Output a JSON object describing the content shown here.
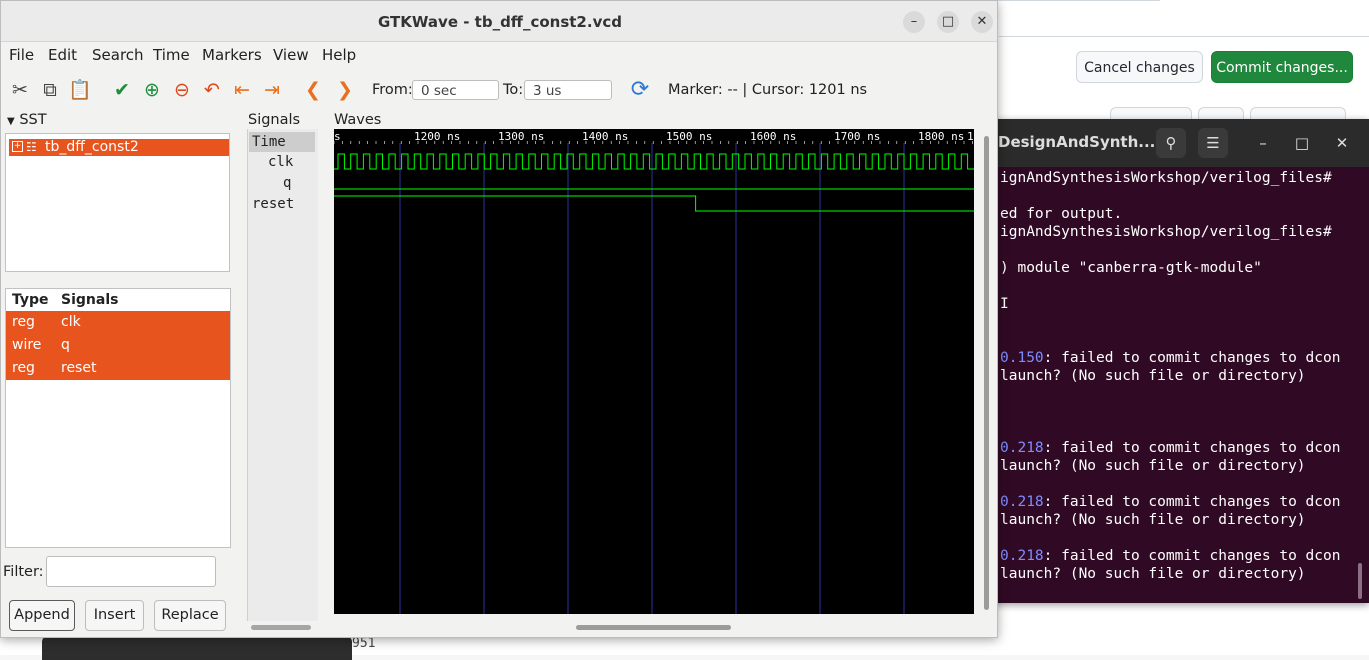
{
  "browser": {
    "cancel_label": "Cancel changes",
    "commit_label": "Commit changes...",
    "code_fragment": "951"
  },
  "terminal": {
    "title": "DesignAndSynth...",
    "lines": [
      {
        "pre": "",
        "num": "",
        "text": "ignAndSynthesisWorkshop/verilog_files#"
      },
      {
        "pre": "",
        "num": "",
        "text": ""
      },
      {
        "pre": "",
        "num": "",
        "text": "ed for output."
      },
      {
        "pre": "",
        "num": "",
        "text": "ignAndSynthesisWorkshop/verilog_files#"
      },
      {
        "pre": "",
        "num": "",
        "text": ""
      },
      {
        "pre": "",
        "num": "",
        "text": ") module \"canberra-gtk-module\""
      },
      {
        "pre": "",
        "num": "",
        "text": ""
      },
      {
        "pre": "",
        "num": "",
        "text": "I"
      },
      {
        "pre": "",
        "num": "",
        "text": ""
      },
      {
        "pre": "",
        "num": "",
        "text": ""
      },
      {
        "pre": "",
        "num": "0.150",
        "text": ": failed to commit changes to dcon"
      },
      {
        "pre": "",
        "num": "",
        "text": "launch? (No such file or directory)"
      },
      {
        "pre": "",
        "num": "",
        "text": ""
      },
      {
        "pre": "",
        "num": "",
        "text": ""
      },
      {
        "pre": "",
        "num": "",
        "text": ""
      },
      {
        "pre": "",
        "num": "0.218",
        "text": ": failed to commit changes to dcon"
      },
      {
        "pre": "",
        "num": "",
        "text": "launch? (No such file or directory)"
      },
      {
        "pre": "",
        "num": "",
        "text": ""
      },
      {
        "pre": "",
        "num": "0.218",
        "text": ": failed to commit changes to dcon"
      },
      {
        "pre": "",
        "num": "",
        "text": "launch? (No such file or directory)"
      },
      {
        "pre": "",
        "num": "",
        "text": ""
      },
      {
        "pre": "",
        "num": "0.218",
        "text": ": failed to commit changes to dcon"
      },
      {
        "pre": "",
        "num": "",
        "text": "launch? (No such file or directory)"
      }
    ]
  },
  "gtkwave": {
    "title": "GTKWave - tb_dff_const2.vcd",
    "menu": [
      "File",
      "Edit",
      "Search",
      "Time",
      "Markers",
      "View",
      "Help"
    ],
    "toolbar": {
      "from_label": "From:",
      "from_value": "0 sec",
      "to_label": "To:",
      "to_value": "3 us",
      "marker_text": "Marker: -- | Cursor: 1201 ns"
    },
    "sst_label": "SST",
    "sst_item": "tb_dff_const2",
    "signals_table": {
      "headers": [
        "Type",
        "Signals"
      ],
      "rows": [
        {
          "type": "reg",
          "name": "clk"
        },
        {
          "type": "wire",
          "name": "q"
        },
        {
          "type": "reg",
          "name": "reset"
        }
      ]
    },
    "filter_label": "Filter:",
    "buttons": {
      "append": "Append",
      "insert": "Insert",
      "replace": "Replace"
    },
    "signals_pane_label": "Signals",
    "signals_list": [
      "Time",
      "clk",
      "q",
      "reset"
    ],
    "waves_label": "Waves",
    "timeline": {
      "ticks": [
        "1200 ns",
        "1300 ns",
        "1400 ns",
        "1500 ns",
        "1600 ns",
        "1700 ns",
        "1800 ns"
      ],
      "edge_left": "s",
      "edge_right": "1"
    },
    "waveforms": {
      "clk_cycles": 50,
      "q_level": 0,
      "reset_fall_fraction": 0.565
    },
    "colors": {
      "wave": "#00ff00",
      "grid": "#3030a0",
      "highlight": "#e8541e"
    }
  }
}
